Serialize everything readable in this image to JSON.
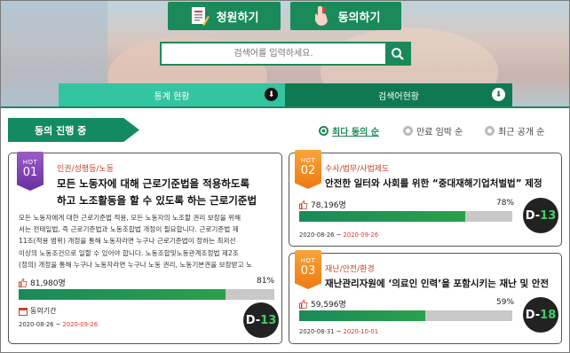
{
  "header": {
    "petition_button": "청원하기",
    "agree_button": "동의하기",
    "search_placeholder": "검색어를 입력하세요."
  },
  "tabs": [
    {
      "label": "통계 현황",
      "active": true
    },
    {
      "label": "검색어현황",
      "active": false
    }
  ],
  "section_title": "동의 진행 중",
  "sort_options": [
    {
      "label": "최다 동의 순",
      "selected": true
    },
    {
      "label": "만료 임박 순",
      "selected": false
    },
    {
      "label": "최근 공개 순",
      "selected": false
    }
  ],
  "colors": {
    "accent": "#1a8a5a",
    "hot1": "#7b3fb0",
    "hot_orange": "#f08a1c",
    "category": "#c3442c",
    "end_date": "#e03030"
  },
  "petitions": [
    {
      "rank_label": "HOT",
      "rank": "01",
      "category": "인권/성평등/노동",
      "title_lines": [
        "모든 노동자에 대해 근로기준법을 적용하도록",
        "하고 노조활동을 할 수 있도록 하는 근로기준법"
      ],
      "body_lines": [
        "모든 노동자에게 대한 근로기준법 적용, 모든 노동자의 노조할 권리 보장을 위해",
        "서는 전태일법, 즉 근로기준법과 노동조합법 개정이 필요합니다. 근로기준법 제",
        "11조(적용 범위) 개정을 통해 노동자라면 누구나 근로기준법이 정하는 최저선",
        "이상의 노동조건으로 일할 수 있어야 합니다. 노동조합및노동관계조정법 제2조",
        "(정의) 개정을 통해 누구나 노동자라면 누구나 노동 권리, 노동기본권을 보장받고 노"
      ],
      "count": "81,980명",
      "percent_label": "81%",
      "percent": 0.81,
      "period_label": "동의기간",
      "start": "2020-08-26",
      "sep": " ~ ",
      "end": "2020-09-26",
      "dday_prefix": "D-",
      "dday_num": "13"
    },
    {
      "rank_label": "HOT",
      "rank": "02",
      "category": "수사/법무/사법제도",
      "title_lines": [
        "안전한 일터와 사회를 위한 “중대재해기업처벌법” 제정"
      ],
      "count": "78,196명",
      "percent_label": "78%",
      "percent": 0.78,
      "start": "2020-08-26",
      "sep": " ~ ",
      "end": "2020-09-26",
      "dday_prefix": "D-",
      "dday_num": "13"
    },
    {
      "rank_label": "HOT",
      "rank": "03",
      "category": "재난/안전/환경",
      "title_lines": [
        "재난관리자원에 ‘의료인 인력’을 포함시키는 재난 및 안전"
      ],
      "count": "59,596명",
      "percent_label": "59%",
      "percent": 0.59,
      "start": "2020-08-31",
      "sep": " ~ ",
      "end": "2020-10-01",
      "dday_prefix": "D-",
      "dday_num": "18"
    }
  ]
}
